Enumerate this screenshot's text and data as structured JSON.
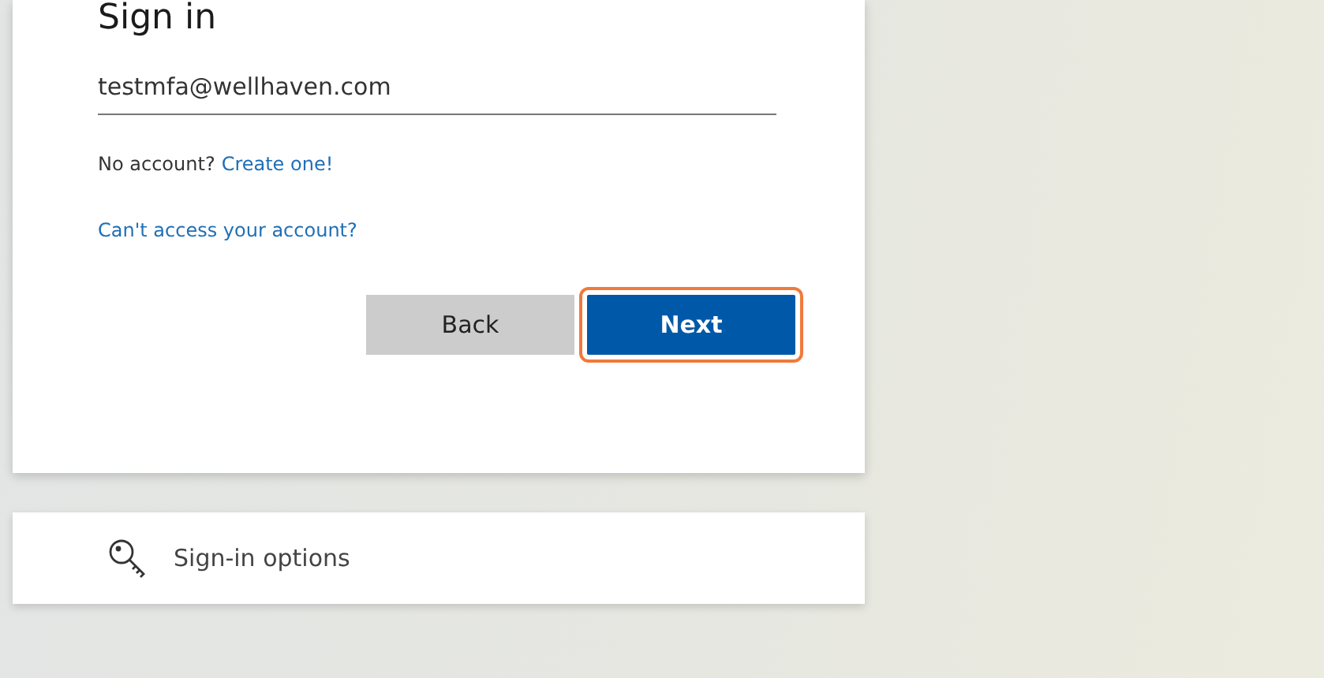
{
  "title": "Sign in",
  "email": {
    "value": "testmfa@wellhaven.com"
  },
  "no_account": {
    "text": "No account?",
    "link": "Create one!"
  },
  "cant_access": "Can't access your account?",
  "buttons": [
    {
      "label": "Back",
      "kind": "secondary",
      "highlighted": false
    },
    {
      "label": "Next",
      "kind": "primary",
      "highlighted": true
    }
  ],
  "sign_in_options": "Sign-in options"
}
